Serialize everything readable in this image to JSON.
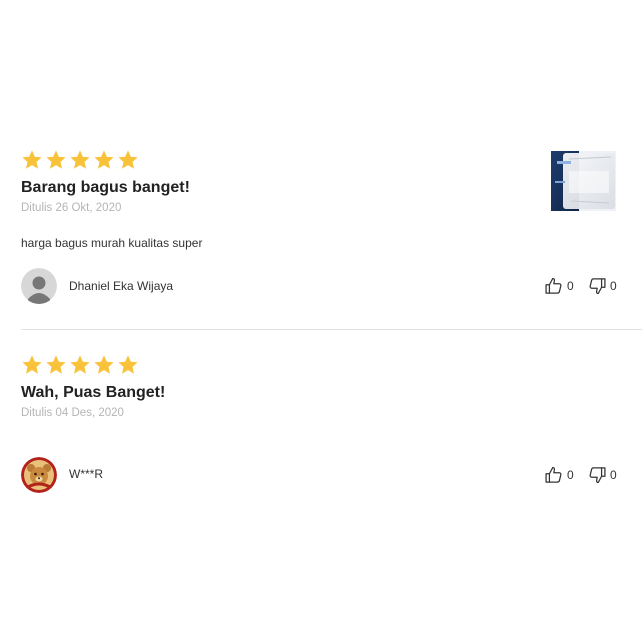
{
  "reviews": [
    {
      "rating": 5,
      "title": "Barang bagus banget!",
      "date": "Ditulis 26 Okt, 2020",
      "body": "harga bagus murah kualitas super",
      "user": "Dhaniel Eka Wijaya",
      "likes": "0",
      "dislikes": "0",
      "avatar_icon": "default-user-icon"
    },
    {
      "rating": 5,
      "title": "Wah, Puas Banget!",
      "date": "Ditulis 04 Des, 2020",
      "body": "",
      "user": "W***R",
      "likes": "0",
      "dislikes": "0",
      "avatar_icon": "bear-avatar-icon"
    }
  ],
  "colors": {
    "star": "#f8c33b",
    "divider": "#e3e3e3",
    "date": "#b5b5b5"
  }
}
